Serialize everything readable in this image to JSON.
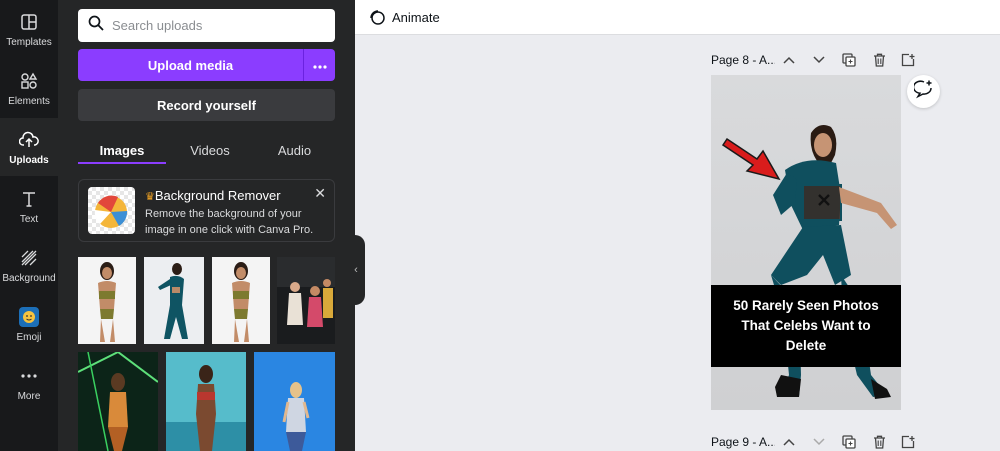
{
  "rail": {
    "items": [
      {
        "label": "Templates",
        "icon": "templates-icon"
      },
      {
        "label": "Elements",
        "icon": "elements-icon"
      },
      {
        "label": "Uploads",
        "icon": "uploads-icon"
      },
      {
        "label": "Text",
        "icon": "text-icon"
      },
      {
        "label": "Background",
        "icon": "background-icon"
      },
      {
        "label": "Emoji",
        "icon": "emoji-icon"
      },
      {
        "label": "More",
        "icon": "more-dots-icon"
      }
    ],
    "active": "Uploads"
  },
  "panel": {
    "search_placeholder": "Search uploads",
    "upload_button": "Upload media",
    "record_button": "Record yourself",
    "tabs": [
      {
        "label": "Images",
        "active": true
      },
      {
        "label": "Videos",
        "active": false
      },
      {
        "label": "Audio",
        "active": false
      }
    ],
    "promo": {
      "title": "Background Remover",
      "crown_icon": "crown-icon",
      "body": "Remove the background of your image in one click with Canva Pro."
    }
  },
  "topbar": {
    "animate_label": "Animate"
  },
  "pages": [
    {
      "label": "Page 8 - A..."
    },
    {
      "label": "Page 9 - A..."
    }
  ],
  "canvas": {
    "caption": "50 Rarely Seen Photos\nThat Celebs Want to\nDelete"
  },
  "colors": {
    "accent": "#8b3dff",
    "rail_bg": "#18191b",
    "panel_bg": "#252627",
    "canvas_bg": "#ebecf0"
  }
}
